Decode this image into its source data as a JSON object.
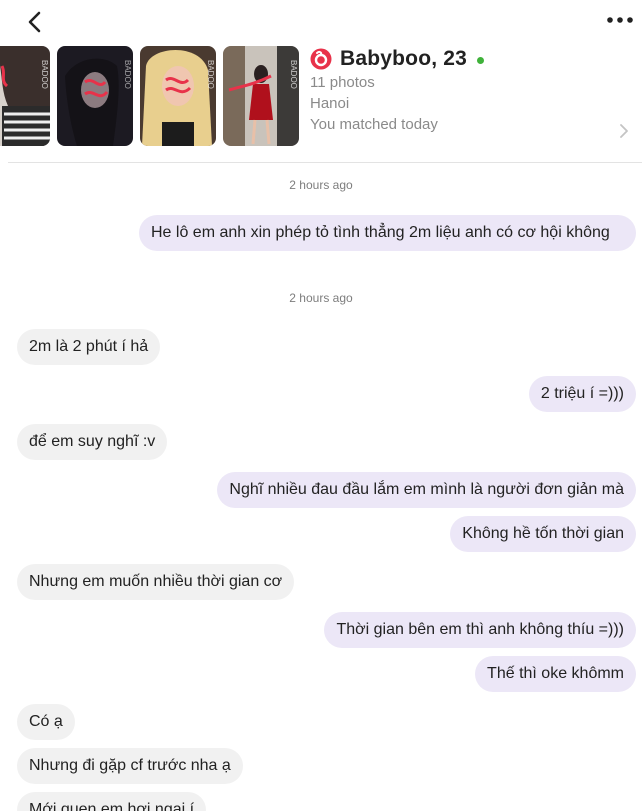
{
  "header": {
    "back_icon": "chevron-left-icon",
    "more_icon": "more-horizontal-icon"
  },
  "profile": {
    "brand_icon": "badoo-logo-icon",
    "name": "Babyboo, 23",
    "photos": "11 photos",
    "city": "Hanoi",
    "matched": "You matched today",
    "thumb_watermark": "BADOO",
    "colors": {
      "online": "#3fb23a",
      "brand": "#e8324a"
    }
  },
  "chat": {
    "timestamps": [
      "2 hours ago",
      "2 hours ago"
    ],
    "messages": [
      {
        "side": "out",
        "text": "He lô em anh xin phép tỏ tình thẳng 2m liệu anh có cơ hội không"
      },
      {
        "side": "in",
        "text": "2m là 2 phút í hả"
      },
      {
        "side": "out",
        "text": "2 triệu í =)))"
      },
      {
        "side": "in",
        "text": "để em suy nghĩ :v"
      },
      {
        "side": "out",
        "text": "Nghĩ nhiều đau đầu lắm em mình là người đơn giản mà"
      },
      {
        "side": "out",
        "text": "Không hề tốn thời gian"
      },
      {
        "side": "in",
        "text": "Nhưng em muốn nhiều thời gian cơ"
      },
      {
        "side": "out",
        "text": "Thời gian bên em thì anh không thíu =)))"
      },
      {
        "side": "out",
        "text": "Thế thì oke khômm"
      },
      {
        "side": "in",
        "text": "Có ạ"
      },
      {
        "side": "in",
        "text": "Nhưng đi gặp cf trước nha ạ"
      },
      {
        "side": "in",
        "text": "Mới quen em hơi ngại í"
      }
    ],
    "colors": {
      "incoming_bubble": "#f1f1f1",
      "outgoing_bubble": "#ece7f7"
    }
  }
}
